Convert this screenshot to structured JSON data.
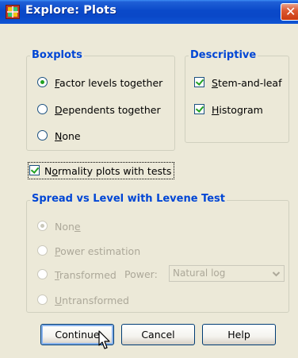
{
  "window": {
    "title": "Explore: Plots",
    "close_glyph": "✕"
  },
  "boxplots": {
    "label": "Boxplots",
    "options": [
      {
        "text": "Factor levels together",
        "accel": "F",
        "selected": true
      },
      {
        "text": "Dependents together",
        "accel": "D",
        "selected": false
      },
      {
        "text": "None",
        "accel": "N",
        "selected": false
      }
    ]
  },
  "descriptive": {
    "label": "Descriptive",
    "options": [
      {
        "text": "Stem-and-leaf",
        "accel": "S",
        "checked": true
      },
      {
        "text": "Histogram",
        "accel": "H",
        "checked": true
      }
    ]
  },
  "normality": {
    "text": "Normality plots with tests",
    "accel": "o",
    "checked": true
  },
  "spread": {
    "label": "Spread vs Level with Levene Test",
    "options": [
      {
        "text": "None",
        "accel": "e",
        "selected": true
      },
      {
        "text": "Power estimation",
        "accel": "P",
        "selected": false
      },
      {
        "text": "Transformed",
        "accel": "T",
        "selected": false
      },
      {
        "text": "Untransformed",
        "accel": "U",
        "selected": false
      }
    ],
    "power_label": "Power:",
    "power_value": "Natural log"
  },
  "buttons": {
    "continue": "Continue",
    "cancel": "Cancel",
    "help": "Help"
  }
}
